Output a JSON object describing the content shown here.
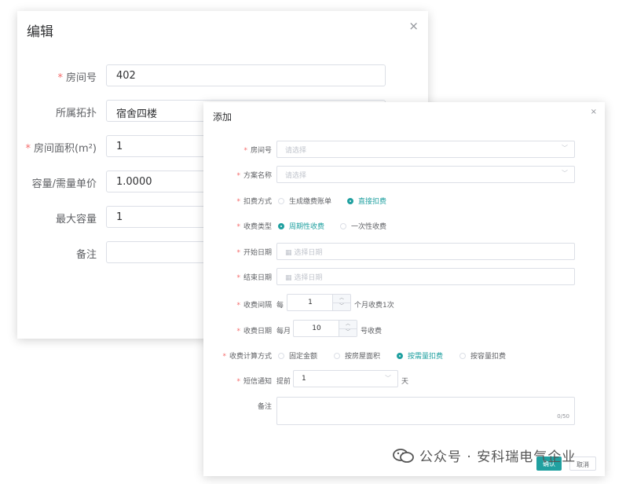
{
  "edit_dialog": {
    "title": "编辑",
    "close": "×",
    "fields": [
      {
        "label": "房间号",
        "required": true,
        "value": "402"
      },
      {
        "label": "所属拓扑",
        "required": false,
        "value": "宿舍四楼"
      },
      {
        "label": "房间面积(m²)",
        "required": true,
        "value": "1"
      },
      {
        "label": "容量/需量单价",
        "required": false,
        "value": "1.0000"
      },
      {
        "label": "最大容量",
        "required": false,
        "value": "1"
      },
      {
        "label": "备注",
        "required": false,
        "value": ""
      }
    ]
  },
  "add_dialog": {
    "title": "添加",
    "close": "×",
    "room_no": {
      "label": "房间号",
      "placeholder": "请选择"
    },
    "plan_name": {
      "label": "方案名称",
      "placeholder": "请选择"
    },
    "deduct_mode": {
      "label": "扣费方式",
      "options": [
        "生成缴费账单",
        "直接扣费"
      ],
      "selected": "直接扣费"
    },
    "charge_type": {
      "label": "收费类型",
      "options": [
        "周期性收费",
        "一次性收费"
      ],
      "selected": "周期性收费"
    },
    "start_date": {
      "label": "开始日期",
      "placeholder": "选择日期"
    },
    "end_date": {
      "label": "结束日期",
      "placeholder": "选择日期"
    },
    "interval": {
      "label": "收费间隔",
      "prefix": "每",
      "value": "1",
      "suffix": "个月收费1次"
    },
    "charge_day": {
      "label": "收费日期",
      "prefix": "每月",
      "value": "10",
      "suffix": "号收费"
    },
    "calc_mode": {
      "label": "收费计算方式",
      "options": [
        "固定金额",
        "按房屋面积",
        "按需量扣费",
        "按容量扣费"
      ],
      "selected": "按需量扣费"
    },
    "sms": {
      "label": "短信通知",
      "prefix": "提前",
      "value": "1",
      "suffix": "天"
    },
    "remark": {
      "label": "备注",
      "counter": "0/50"
    },
    "confirm_label": "确认",
    "cancel_label": "取消"
  },
  "watermark": "公众号 · 安科瑞电气企业"
}
